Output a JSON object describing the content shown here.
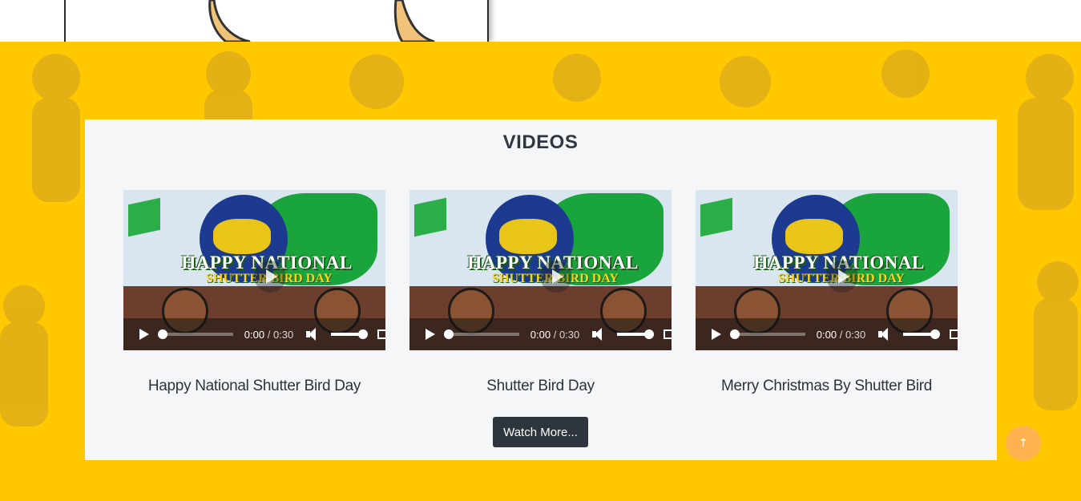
{
  "section": {
    "title": "VIDEOS"
  },
  "videos": [
    {
      "title": "Happy National Shutter Bird Day",
      "thumbnail_line1": "HAPPY NATIONAL",
      "thumbnail_line2": "SHUTTER BIRD DAY",
      "current_time": "0:00",
      "separator": "/",
      "duration": "0:30"
    },
    {
      "title": "Shutter Bird Day",
      "thumbnail_line1": "HAPPY NATIONAL",
      "thumbnail_line2": "SHUTTER BIRD DAY",
      "current_time": "0:00",
      "separator": "/",
      "duration": "0:30"
    },
    {
      "title": "Merry Christmas By Shutter Bird",
      "thumbnail_line1": "HAPPY NATIONAL",
      "thumbnail_line2": "SHUTTER BIRD DAY",
      "current_time": "0:00",
      "separator": "/",
      "duration": "0:30"
    }
  ],
  "actions": {
    "watch_more": "Watch More...",
    "scroll_top": "↑"
  },
  "colors": {
    "background": "#ffc800",
    "panel": "#f5f6f8",
    "button": "#2f353c",
    "scroll_top": "#ffb24d"
  }
}
